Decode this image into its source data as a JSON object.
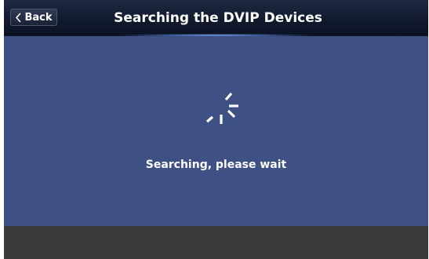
{
  "header": {
    "back_label": "Back",
    "title": "Searching the DVIP Devices"
  },
  "main": {
    "status_text": "Searching, please wait",
    "spinner_icon": "loading-spinner-icon"
  },
  "colors": {
    "titlebar": "#121a2e",
    "content_background": "#3f5084",
    "bottom_bar": "#3b3b3b",
    "text": "#ffffff"
  }
}
